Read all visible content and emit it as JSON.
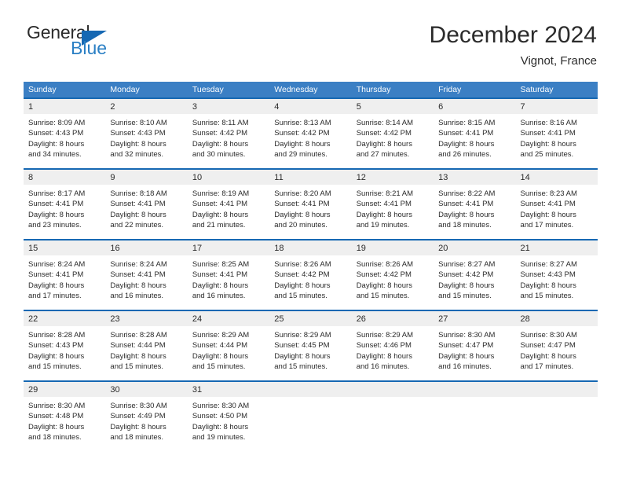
{
  "brand": {
    "name_part1": "General",
    "name_part2": "Blue",
    "triangle_color": "#1668b3",
    "blue_text_color": "#2a7fc4"
  },
  "header": {
    "month_title": "December 2024",
    "location": "Vignot, France"
  },
  "theme": {
    "header_row_bg": "#3b7fc4",
    "cell_top_border": "#1668b3",
    "daynum_band_bg": "#efefef",
    "text_color": "#2b2b2b"
  },
  "weekdays": [
    "Sunday",
    "Monday",
    "Tuesday",
    "Wednesday",
    "Thursday",
    "Friday",
    "Saturday"
  ],
  "weeks": [
    {
      "days": [
        {
          "num": "1",
          "sunrise": "Sunrise: 8:09 AM",
          "sunset": "Sunset: 4:43 PM",
          "daylight1": "Daylight: 8 hours",
          "daylight2": "and 34 minutes."
        },
        {
          "num": "2",
          "sunrise": "Sunrise: 8:10 AM",
          "sunset": "Sunset: 4:43 PM",
          "daylight1": "Daylight: 8 hours",
          "daylight2": "and 32 minutes."
        },
        {
          "num": "3",
          "sunrise": "Sunrise: 8:11 AM",
          "sunset": "Sunset: 4:42 PM",
          "daylight1": "Daylight: 8 hours",
          "daylight2": "and 30 minutes."
        },
        {
          "num": "4",
          "sunrise": "Sunrise: 8:13 AM",
          "sunset": "Sunset: 4:42 PM",
          "daylight1": "Daylight: 8 hours",
          "daylight2": "and 29 minutes."
        },
        {
          "num": "5",
          "sunrise": "Sunrise: 8:14 AM",
          "sunset": "Sunset: 4:42 PM",
          "daylight1": "Daylight: 8 hours",
          "daylight2": "and 27 minutes."
        },
        {
          "num": "6",
          "sunrise": "Sunrise: 8:15 AM",
          "sunset": "Sunset: 4:41 PM",
          "daylight1": "Daylight: 8 hours",
          "daylight2": "and 26 minutes."
        },
        {
          "num": "7",
          "sunrise": "Sunrise: 8:16 AM",
          "sunset": "Sunset: 4:41 PM",
          "daylight1": "Daylight: 8 hours",
          "daylight2": "and 25 minutes."
        }
      ]
    },
    {
      "days": [
        {
          "num": "8",
          "sunrise": "Sunrise: 8:17 AM",
          "sunset": "Sunset: 4:41 PM",
          "daylight1": "Daylight: 8 hours",
          "daylight2": "and 23 minutes."
        },
        {
          "num": "9",
          "sunrise": "Sunrise: 8:18 AM",
          "sunset": "Sunset: 4:41 PM",
          "daylight1": "Daylight: 8 hours",
          "daylight2": "and 22 minutes."
        },
        {
          "num": "10",
          "sunrise": "Sunrise: 8:19 AM",
          "sunset": "Sunset: 4:41 PM",
          "daylight1": "Daylight: 8 hours",
          "daylight2": "and 21 minutes."
        },
        {
          "num": "11",
          "sunrise": "Sunrise: 8:20 AM",
          "sunset": "Sunset: 4:41 PM",
          "daylight1": "Daylight: 8 hours",
          "daylight2": "and 20 minutes."
        },
        {
          "num": "12",
          "sunrise": "Sunrise: 8:21 AM",
          "sunset": "Sunset: 4:41 PM",
          "daylight1": "Daylight: 8 hours",
          "daylight2": "and 19 minutes."
        },
        {
          "num": "13",
          "sunrise": "Sunrise: 8:22 AM",
          "sunset": "Sunset: 4:41 PM",
          "daylight1": "Daylight: 8 hours",
          "daylight2": "and 18 minutes."
        },
        {
          "num": "14",
          "sunrise": "Sunrise: 8:23 AM",
          "sunset": "Sunset: 4:41 PM",
          "daylight1": "Daylight: 8 hours",
          "daylight2": "and 17 minutes."
        }
      ]
    },
    {
      "days": [
        {
          "num": "15",
          "sunrise": "Sunrise: 8:24 AM",
          "sunset": "Sunset: 4:41 PM",
          "daylight1": "Daylight: 8 hours",
          "daylight2": "and 17 minutes."
        },
        {
          "num": "16",
          "sunrise": "Sunrise: 8:24 AM",
          "sunset": "Sunset: 4:41 PM",
          "daylight1": "Daylight: 8 hours",
          "daylight2": "and 16 minutes."
        },
        {
          "num": "17",
          "sunrise": "Sunrise: 8:25 AM",
          "sunset": "Sunset: 4:41 PM",
          "daylight1": "Daylight: 8 hours",
          "daylight2": "and 16 minutes."
        },
        {
          "num": "18",
          "sunrise": "Sunrise: 8:26 AM",
          "sunset": "Sunset: 4:42 PM",
          "daylight1": "Daylight: 8 hours",
          "daylight2": "and 15 minutes."
        },
        {
          "num": "19",
          "sunrise": "Sunrise: 8:26 AM",
          "sunset": "Sunset: 4:42 PM",
          "daylight1": "Daylight: 8 hours",
          "daylight2": "and 15 minutes."
        },
        {
          "num": "20",
          "sunrise": "Sunrise: 8:27 AM",
          "sunset": "Sunset: 4:42 PM",
          "daylight1": "Daylight: 8 hours",
          "daylight2": "and 15 minutes."
        },
        {
          "num": "21",
          "sunrise": "Sunrise: 8:27 AM",
          "sunset": "Sunset: 4:43 PM",
          "daylight1": "Daylight: 8 hours",
          "daylight2": "and 15 minutes."
        }
      ]
    },
    {
      "days": [
        {
          "num": "22",
          "sunrise": "Sunrise: 8:28 AM",
          "sunset": "Sunset: 4:43 PM",
          "daylight1": "Daylight: 8 hours",
          "daylight2": "and 15 minutes."
        },
        {
          "num": "23",
          "sunrise": "Sunrise: 8:28 AM",
          "sunset": "Sunset: 4:44 PM",
          "daylight1": "Daylight: 8 hours",
          "daylight2": "and 15 minutes."
        },
        {
          "num": "24",
          "sunrise": "Sunrise: 8:29 AM",
          "sunset": "Sunset: 4:44 PM",
          "daylight1": "Daylight: 8 hours",
          "daylight2": "and 15 minutes."
        },
        {
          "num": "25",
          "sunrise": "Sunrise: 8:29 AM",
          "sunset": "Sunset: 4:45 PM",
          "daylight1": "Daylight: 8 hours",
          "daylight2": "and 15 minutes."
        },
        {
          "num": "26",
          "sunrise": "Sunrise: 8:29 AM",
          "sunset": "Sunset: 4:46 PM",
          "daylight1": "Daylight: 8 hours",
          "daylight2": "and 16 minutes."
        },
        {
          "num": "27",
          "sunrise": "Sunrise: 8:30 AM",
          "sunset": "Sunset: 4:47 PM",
          "daylight1": "Daylight: 8 hours",
          "daylight2": "and 16 minutes."
        },
        {
          "num": "28",
          "sunrise": "Sunrise: 8:30 AM",
          "sunset": "Sunset: 4:47 PM",
          "daylight1": "Daylight: 8 hours",
          "daylight2": "and 17 minutes."
        }
      ]
    },
    {
      "days": [
        {
          "num": "29",
          "sunrise": "Sunrise: 8:30 AM",
          "sunset": "Sunset: 4:48 PM",
          "daylight1": "Daylight: 8 hours",
          "daylight2": "and 18 minutes."
        },
        {
          "num": "30",
          "sunrise": "Sunrise: 8:30 AM",
          "sunset": "Sunset: 4:49 PM",
          "daylight1": "Daylight: 8 hours",
          "daylight2": "and 18 minutes."
        },
        {
          "num": "31",
          "sunrise": "Sunrise: 8:30 AM",
          "sunset": "Sunset: 4:50 PM",
          "daylight1": "Daylight: 8 hours",
          "daylight2": "and 19 minutes."
        },
        {
          "num": "",
          "sunrise": "",
          "sunset": "",
          "daylight1": "",
          "daylight2": ""
        },
        {
          "num": "",
          "sunrise": "",
          "sunset": "",
          "daylight1": "",
          "daylight2": ""
        },
        {
          "num": "",
          "sunrise": "",
          "sunset": "",
          "daylight1": "",
          "daylight2": ""
        },
        {
          "num": "",
          "sunrise": "",
          "sunset": "",
          "daylight1": "",
          "daylight2": ""
        }
      ]
    }
  ]
}
